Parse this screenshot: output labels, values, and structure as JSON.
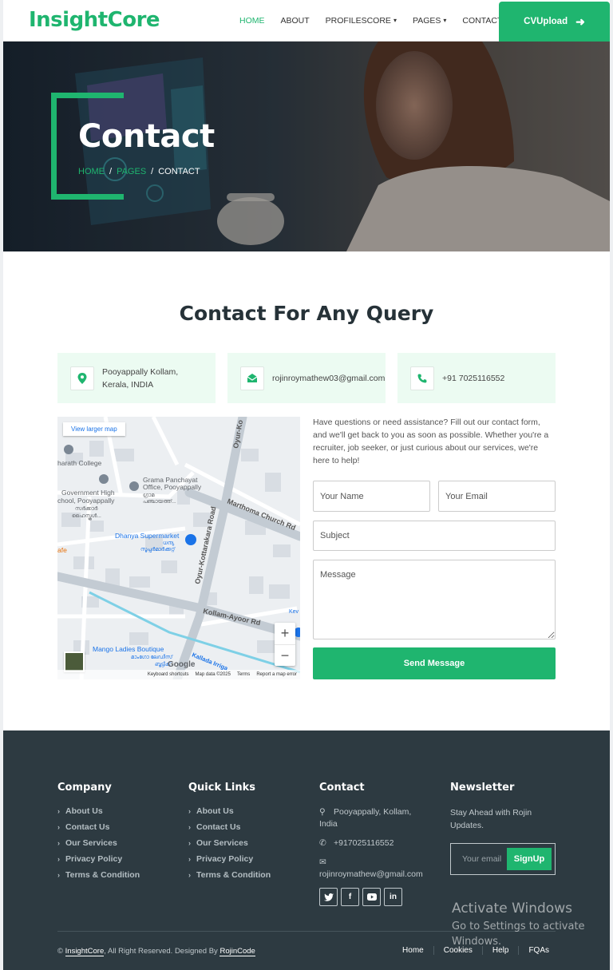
{
  "navbar": {
    "brand": "InsightCore",
    "links": [
      {
        "label": "HOME",
        "active": true,
        "dropdown": false
      },
      {
        "label": "ABOUT",
        "active": false,
        "dropdown": false
      },
      {
        "label": "PROFILESCORE",
        "active": false,
        "dropdown": true
      },
      {
        "label": "PAGES",
        "active": false,
        "dropdown": true
      },
      {
        "label": "CONTACT",
        "active": false,
        "dropdown": false
      }
    ],
    "cta_label": "CVUpload",
    "cta_icon": "arrow-right-icon"
  },
  "hero": {
    "title": "Contact",
    "breadcrumb": [
      "HOME",
      "PAGES",
      "CONTACT"
    ]
  },
  "contact": {
    "title": "Contact For Any Query",
    "address_line1": "Pooyappally Kollam,",
    "address_line2": "Kerala, INDIA",
    "email": "rojinroymathew03@gmail.com",
    "phone": "+91 7025116552"
  },
  "map": {
    "view_larger": "View larger map",
    "labels": {
      "college": "harath College",
      "school1": "Government High",
      "school2": "chool, Pooyappally",
      "school3": "സർക്കാർ",
      "school4": "ഹൈസ്കൂൾ...",
      "panchayat1": "Grama Panchayat",
      "panchayat2": "Office, Pooyappally",
      "panchayat3": "ഗ്രാമ",
      "panchayat4": "പഞ്ചായത്ത്...",
      "supermarket": "Dhanya Supermarket",
      "supermarket_ml1": "ധന്യ",
      "supermarket_ml2": "സൂപ്പർമാർക്കറ്റ്",
      "cafe": "afe",
      "road_oyur_top": "Oyur-Ko",
      "road_oyur": "Oyur-Kottarakara Road",
      "road_marthoma": "Marthoma Church Rd",
      "road_kollam": "Kollam-Ayoor Rd",
      "boutique1": "Mango Ladies Boutique",
      "boutique2": "മാംഗോ ലേഡീസ്",
      "boutique3": "ബൂട്ടിക്",
      "kallada": "Kallada Irriga",
      "kev": "Kev"
    },
    "zoom_in": "+",
    "zoom_out": "−",
    "google": "Google",
    "footer": [
      "Keyboard shortcuts",
      "Map data ©2025",
      "Terms",
      "Report a map error"
    ]
  },
  "form": {
    "intro": "Have questions or need assistance? Fill out our contact form, and we'll get back to you as soon as possible. Whether you're a recruiter, job seeker, or just curious about our services, we're here to help!",
    "name_placeholder": "Your Name",
    "email_placeholder": "Your Email",
    "subject_placeholder": "Subject",
    "message_placeholder": "Message",
    "submit_label": "Send Message"
  },
  "footer": {
    "company": {
      "title": "Company",
      "links": [
        "About Us",
        "Contact Us",
        "Our Services",
        "Privacy Policy",
        "Terms & Condition"
      ]
    },
    "quick_links": {
      "title": "Quick Links",
      "links": [
        "About Us",
        "Contact Us",
        "Our Services",
        "Privacy Policy",
        "Terms & Condition"
      ]
    },
    "contact": {
      "title": "Contact",
      "address_line1": "Pooyappally, Kollam,",
      "address_line2": "India",
      "phone": "+917025116552",
      "email": "rojinroymathew@gmail.com",
      "socials": [
        "twitter-icon",
        "facebook-icon",
        "youtube-icon",
        "linkedin-icon"
      ]
    },
    "newsletter": {
      "title": "Newsletter",
      "text": "Stay Ahead with Rojin Updates.",
      "placeholder": "Your email",
      "button": "SignUp"
    },
    "copyright_symbol": "©",
    "brand": "InsightCore",
    "copyright_mid": ", All Right Reserved. Designed By",
    "designer": "RojinCode",
    "bottom_links": [
      "Home",
      "Cookies",
      "Help",
      "FQAs"
    ],
    "watermark_line1": "Activate Windows",
    "watermark_line2": "Go to Settings to activate",
    "watermark_line3": "Windows."
  },
  "colors": {
    "accent": "#1fb56f",
    "footer_bg": "#2d3a41",
    "info_bg": "#ecfbf2",
    "heading": "#263238"
  }
}
